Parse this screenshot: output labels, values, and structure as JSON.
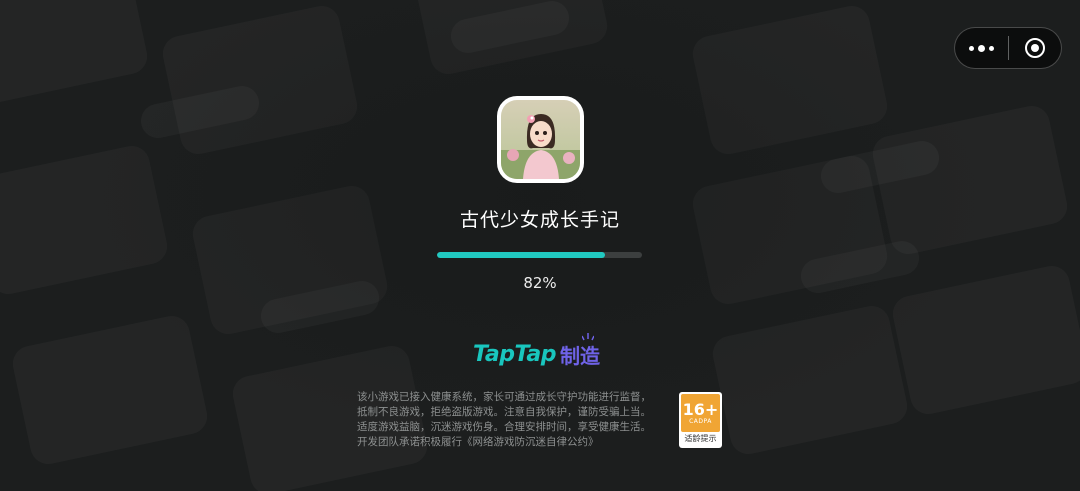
{
  "game": {
    "title": "古代少女成长手记",
    "progress_text": "82%",
    "progress_value": 0.82
  },
  "brand": {
    "tap_text": "TapTap",
    "made_text": "制造"
  },
  "notice": {
    "lines": [
      "该小游戏已接入健康系统，家长可通过成长守护功能进行监督，",
      "抵制不良游戏，拒绝盗版游戏。注意自我保护，谨防受骗上当。",
      "适度游戏益脑，沉迷游戏伤身。合理安排时间，享受健康生活。",
      "开发团队承诺积极履行《网络游戏防沉迷自律公约》"
    ]
  },
  "age_rating": {
    "value": "16+",
    "org": "CADPA",
    "label": "适龄提示"
  },
  "colors": {
    "accent": "#21c9c1",
    "brand_tap": "#19c6be",
    "brand_made": "#6f63e8",
    "age_badge": "#f0a534"
  },
  "icons": {
    "menu": "more-dots-icon",
    "close": "close-target-icon"
  }
}
